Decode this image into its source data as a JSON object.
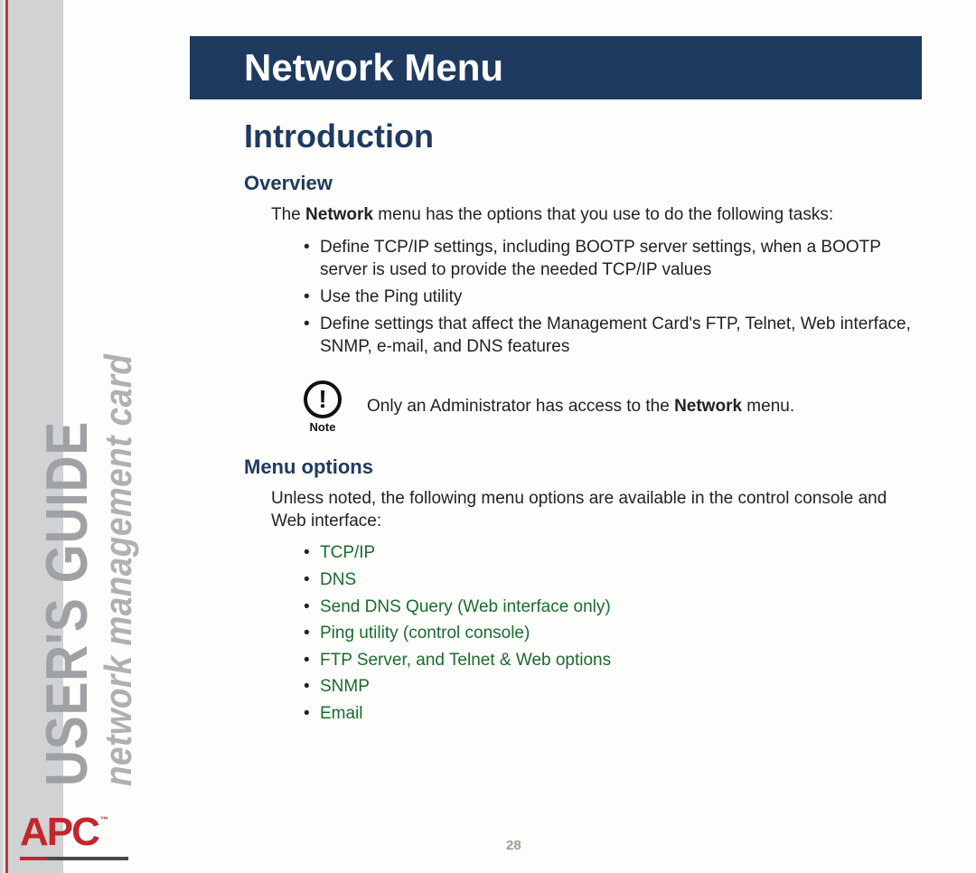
{
  "sidebar": {
    "title": "USER'S GUIDE",
    "subtitle": "network management card"
  },
  "logo": {
    "text": "APC",
    "tm": "™"
  },
  "header": {
    "title": "Network Menu"
  },
  "section": {
    "title": "Introduction",
    "overview": {
      "heading": "Overview",
      "intro_pre": "The ",
      "intro_bold": "Network",
      "intro_post": " menu has the options that you use to do the following tasks:",
      "bullets": [
        "Define TCP/IP settings, including BOOTP server settings, when a BOOTP server is used to provide the needed TCP/IP values",
        "Use the Ping utility",
        "Define settings that affect the Management Card's FTP, Telnet, Web interface, SNMP, e-mail, and DNS features"
      ],
      "note_label": "Note",
      "note_pre": "Only an Administrator has access to the ",
      "note_bold": "Network",
      "note_post": " menu."
    },
    "menu": {
      "heading": "Menu options",
      "intro": "Unless noted, the following menu options are available in the control console and Web interface:",
      "links": [
        "TCP/IP",
        "DNS",
        "Send DNS Query (Web interface only)",
        "Ping utility (control console)",
        "FTP Server, and Telnet & Web options",
        "SNMP",
        "Email"
      ]
    }
  },
  "page_number": "28"
}
